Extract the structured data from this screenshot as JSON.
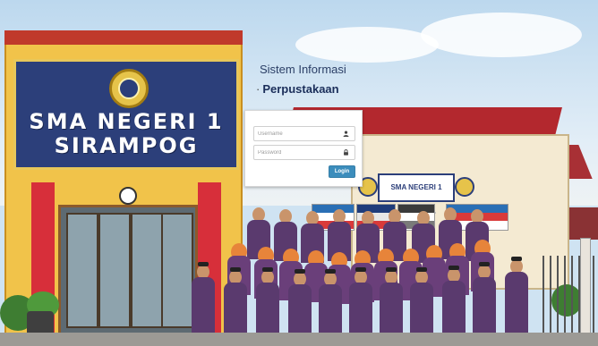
{
  "header": {
    "title": "Sistem Informasi",
    "subtitle": "Perpustakaan"
  },
  "background": {
    "school_sign": {
      "line1": "SMA NEGERI 1",
      "line2": "SIRAMPOG"
    },
    "wall_sign": "SMA NEGERI 1 SIRAMPOG"
  },
  "login": {
    "username_placeholder": "Username",
    "password_placeholder": "Password",
    "button_label": "Login",
    "username_icon": "user-icon",
    "password_icon": "lock-icon"
  },
  "colors": {
    "button": "#3c8dbc",
    "title_text": "#1b2e5a"
  }
}
